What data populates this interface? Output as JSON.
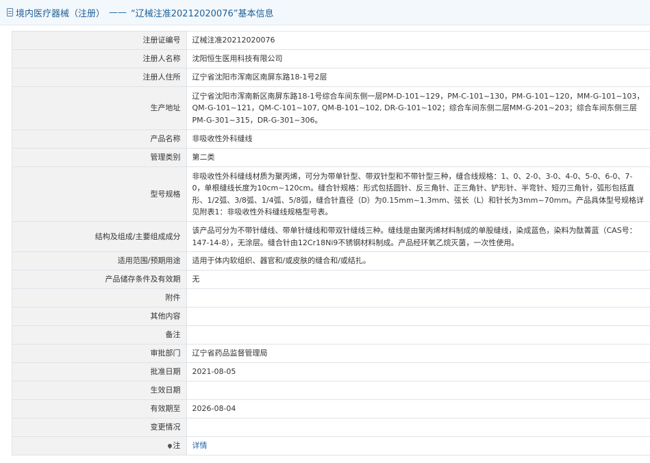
{
  "header": {
    "category": "境内医疗器械（注册）",
    "separator": "——",
    "title": "“辽械注准20212020076”基本信息"
  },
  "rows": [
    {
      "label": "注册证编号",
      "value": "辽械注准20212020076"
    },
    {
      "label": "注册人名称",
      "value": "沈阳恒生医用科技有限公司"
    },
    {
      "label": "注册人住所",
      "value": "辽宁省沈阳市浑南区南屏东路18-1号2层"
    },
    {
      "label": "生产地址",
      "value": "辽宁省沈阳市浑南新区南屏东路18-1号综合车间东侧一层PM-D-101~129，PM-C-101~130，PM-G-101~120，MM-G-101~103，QM-G-101~121，QM-C-101~107, QM-B-101~102, DR-G-101~102；综合车间东侧二层MM-G-201~203；综合车间东侧三层PM-G-301~315，DR-G-301~306。"
    },
    {
      "label": "产品名称",
      "value": "非吸收性外科缝线"
    },
    {
      "label": "管理类别",
      "value": "第二类"
    },
    {
      "label": "型号规格",
      "value": "非吸收性外科缝线材质为聚丙烯，可分为带单针型、带双针型和不带针型三种，缝合线规格：1、0、2-0、3-0、4-0、5-0、6-0、7-0，单根缝线长度为10cm~120cm。缝合针规格：形式包括圆针、反三角针、正三角针、铲形针、半弯针、短刃三角针，弧形包括直形、1/2弧、3/8弧、1/4弧、5/8弧，缝合针直径（D）为0.15mm~1.3mm、弦长（L）和针长为3mm~70mm。产品具体型号规格详见附表1：非吸收性外科缝线规格型号表。"
    },
    {
      "label": "结构及组成/主要组成成分",
      "value": "该产品可分为不带针缝线、带单针缝线和带双针缝线三种。缝线是由聚丙烯材料制成的单股缝线，染成蓝色，染料为酞菁蓝（CAS号：147-14-8），无涂层。缝合针由12Cr18Ni9不锈钢材料制成。产品经环氧乙烷灭菌，一次性使用。"
    },
    {
      "label": "适用范围/预期用途",
      "value": "适用于体内软组织、器官和/或皮肤的缝合和/或结扎。"
    },
    {
      "label": "产品储存条件及有效期",
      "value": "无"
    },
    {
      "label": "附件",
      "value": ""
    },
    {
      "label": "其他内容",
      "value": ""
    },
    {
      "label": "备注",
      "value": ""
    },
    {
      "label": "审批部门",
      "value": "辽宁省药品监督管理局"
    },
    {
      "label": "批准日期",
      "value": "2021-08-05"
    },
    {
      "label": "生效日期",
      "value": ""
    },
    {
      "label": "有效期至",
      "value": "2026-08-04"
    },
    {
      "label": "变更情况",
      "value": ""
    }
  ],
  "note": {
    "label": "注",
    "icon": "pin-icon",
    "link": "详情"
  }
}
